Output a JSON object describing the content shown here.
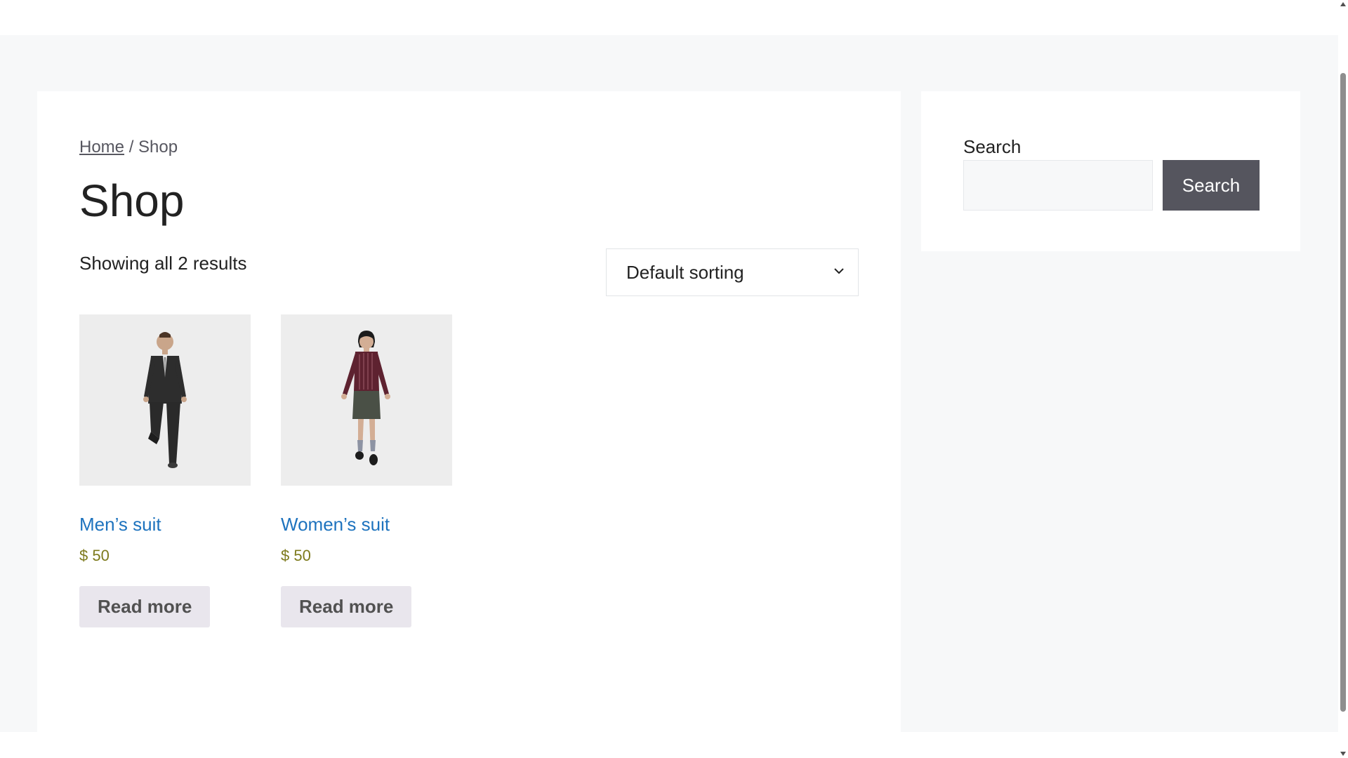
{
  "breadcrumb": {
    "home": "Home",
    "separator": " / ",
    "current": "Shop"
  },
  "page": {
    "title": "Shop",
    "result_count": "Showing all 2 results"
  },
  "sorting": {
    "selected": "Default sorting"
  },
  "products": [
    {
      "title": "Men’s suit",
      "price": "$ 50",
      "button": "Read more",
      "image_icon": "mens-suit-figure"
    },
    {
      "title": "Women’s suit",
      "price": "$ 50",
      "button": "Read more",
      "image_icon": "womens-suit-figure"
    }
  ],
  "sidebar": {
    "search_label": "Search",
    "search_button": "Search",
    "search_placeholder": ""
  },
  "colors": {
    "link": "#1e73be",
    "price": "#7d7a1c",
    "button_bg": "#e9e6ed",
    "search_button_bg": "#55555e",
    "page_bg": "#f7f8f9"
  }
}
